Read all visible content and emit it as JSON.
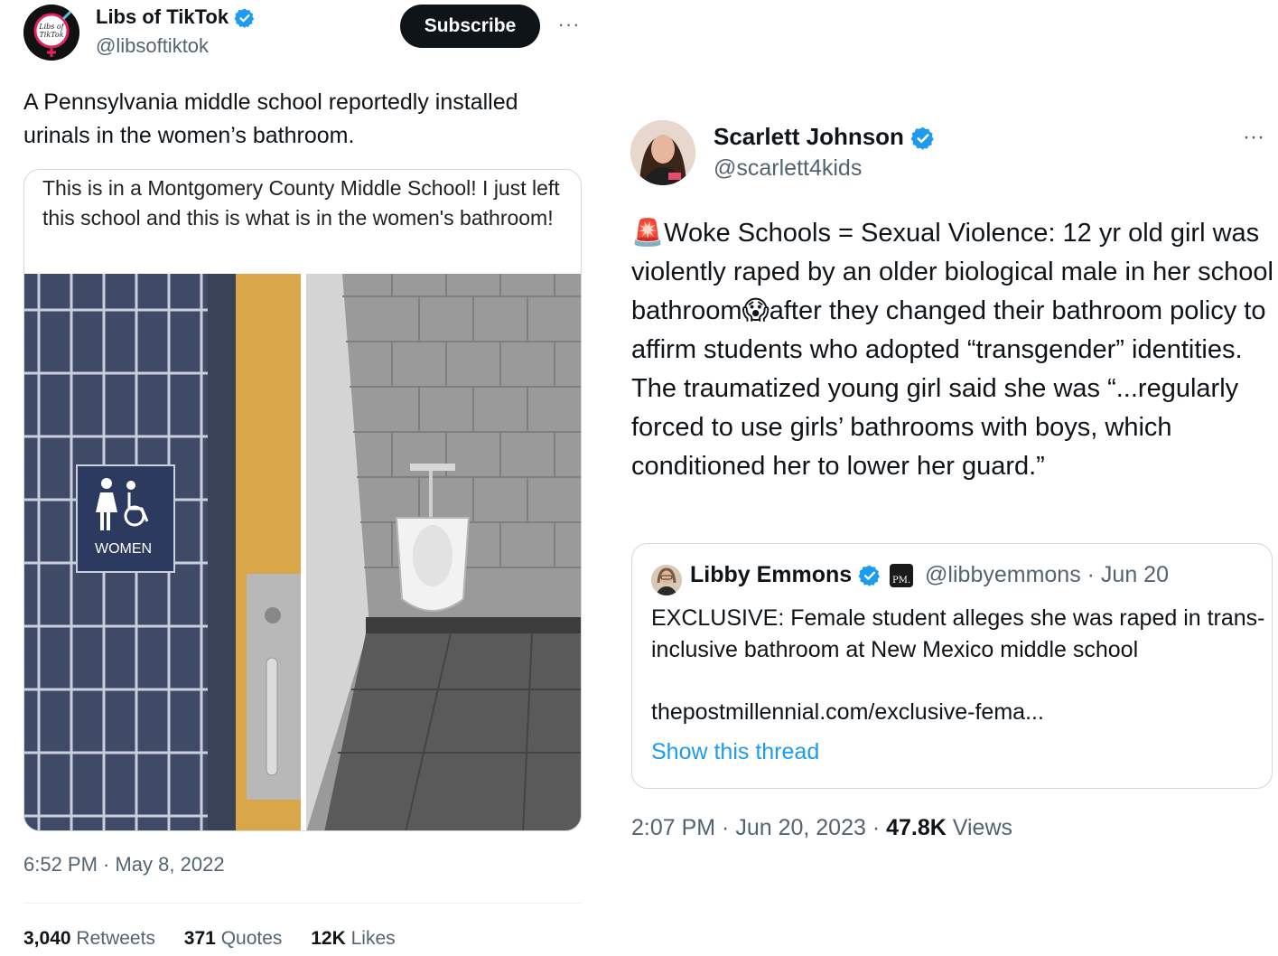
{
  "left_tweet": {
    "author_name": "Libs of TikTok",
    "author_handle": "@libsoftiktok",
    "avatar_text": "Libs of TikTok",
    "subscribe_label": "Subscribe",
    "more_label": "···",
    "text": "A Pennsylvania middle school reportedly installed urinals in the women’s bathroom.",
    "media": {
      "caption": "This is in a Montgomery County Middle School! I just left this school and this is what is in the women's bathroom!",
      "sign_label": "WOMEN"
    },
    "timestamp": "6:52 PM · May 8, 2022",
    "stats": {
      "retweets_count": "3,040",
      "retweets_label": "Retweets",
      "quotes_count": "371",
      "quotes_label": "Quotes",
      "likes_count": "12K",
      "likes_label": "Likes"
    }
  },
  "right_tweet": {
    "author_name": "Scarlett Johnson",
    "author_handle": "@scarlett4kids",
    "more_label": "···",
    "text_parts": {
      "siren_emoji": "🚨",
      "part1": "Woke Schools = Sexual Violence: 12 yr old girl was violently raped by an older biological male in her school bathroom",
      "scream_emoji": "😱",
      "part2": "after they changed their bathroom policy to affirm students who adopted “transgender” identities. The traumatized young girl said she was “...regularly forced to use girls’ bathrooms with boys, which conditioned her to lower her guard.”"
    },
    "quote": {
      "author_name": "Libby Emmons",
      "badge_text": "PM.",
      "handle_date": "@libbyemmons · Jun 20",
      "text": "EXCLUSIVE: Female student alleges she was raped in trans-inclusive bathroom at New Mexico middle school",
      "link": "thepostmillennial.com/exclusive-fema...",
      "show_thread": "Show this thread"
    },
    "timestamp": "2:07 PM · Jun 20, 2023 · ",
    "views_count": "47.8K",
    "views_label": " Views"
  },
  "colors": {
    "text": "#0f1419",
    "muted": "#536471",
    "link": "#1d9bf0",
    "verified": "#1d9bf0",
    "border": "#cfd9de"
  }
}
